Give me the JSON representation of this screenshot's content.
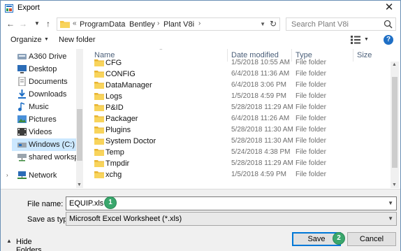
{
  "window": {
    "title": "Export",
    "close_glyph": "✕"
  },
  "address": {
    "overflow": "«",
    "crumbs": [
      "ProgramData",
      "Bentley",
      "Plant V8i"
    ],
    "search_placeholder": "Search Plant V8i"
  },
  "toolbar": {
    "organize_label": "Organize",
    "new_folder_label": "New folder",
    "help_label": "?"
  },
  "nav": {
    "items": [
      {
        "label": "A360 Drive",
        "icon": "cloud-drive-icon"
      },
      {
        "label": "Desktop",
        "icon": "desktop-icon"
      },
      {
        "label": "Documents",
        "icon": "documents-icon"
      },
      {
        "label": "Downloads",
        "icon": "downloads-icon"
      },
      {
        "label": "Music",
        "icon": "music-icon"
      },
      {
        "label": "Pictures",
        "icon": "pictures-icon"
      },
      {
        "label": "Videos",
        "icon": "videos-icon"
      },
      {
        "label": "Windows (C:)",
        "icon": "drive-icon"
      },
      {
        "label": "shared workspace",
        "icon": "network-drive-icon"
      },
      {
        "label": "Network",
        "icon": "network-icon"
      }
    ],
    "selected": "Windows (C:)"
  },
  "list": {
    "columns": {
      "name": "Name",
      "date": "Date modified",
      "type": "Type",
      "size": "Size"
    },
    "rows": [
      {
        "name": "CFG",
        "date": "1/5/2018 10:55 AM",
        "type": "File folder"
      },
      {
        "name": "CONFIG",
        "date": "6/4/2018 11:36 AM",
        "type": "File folder"
      },
      {
        "name": "DataManager",
        "date": "6/4/2018 3:06 PM",
        "type": "File folder"
      },
      {
        "name": "Logs",
        "date": "1/5/2018 4:59 PM",
        "type": "File folder"
      },
      {
        "name": "P&ID",
        "date": "5/28/2018 11:29 AM",
        "type": "File folder"
      },
      {
        "name": "Packager",
        "date": "6/4/2018 11:26 AM",
        "type": "File folder"
      },
      {
        "name": "Plugins",
        "date": "5/28/2018 11:30 AM",
        "type": "File folder"
      },
      {
        "name": "System Doctor",
        "date": "5/28/2018 11:30 AM",
        "type": "File folder"
      },
      {
        "name": "Temp",
        "date": "5/24/2018 4:38 PM",
        "type": "File folder"
      },
      {
        "name": "Tmpdir",
        "date": "5/28/2018 11:29 AM",
        "type": "File folder"
      },
      {
        "name": "xchg",
        "date": "1/5/2018 4:59 PM",
        "type": "File folder"
      }
    ]
  },
  "form": {
    "file_name_label": "File name:",
    "file_name_value": "EQUIP.xls",
    "save_as_type_label": "Save as type:",
    "save_as_type_value": "Microsoft Excel Worksheet (*.xls)"
  },
  "footer": {
    "hide_folders_label": "Hide Folders",
    "save_label": "Save",
    "cancel_label": "Cancel"
  },
  "callouts": {
    "step1": "1",
    "step2": "2"
  },
  "colors": {
    "accent": "#0078d7",
    "folder": "#f5c542",
    "callout": "#3aa76d",
    "selection": "#cce8ff"
  }
}
